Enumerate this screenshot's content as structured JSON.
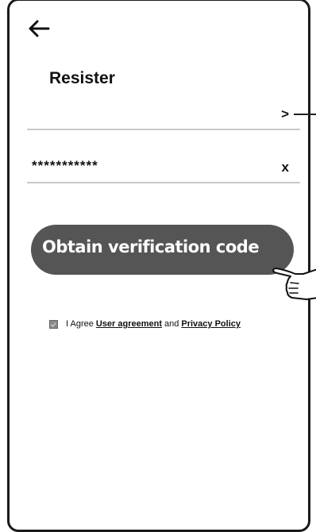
{
  "header": {
    "back_icon": "back-arrow-icon",
    "title": "Resister"
  },
  "form": {
    "account_field": {
      "value": "",
      "action": ">"
    },
    "password_field": {
      "value": "***********",
      "action": "x"
    },
    "obtain_button_label": "Obtain verification code"
  },
  "agreement": {
    "checked": true,
    "prefix": "I Agree",
    "user_agreement_link": "User agreement",
    "and_text": "and",
    "privacy_link": "Privacy Policy"
  },
  "annotation": {
    "pointer_icon": "pointing-hand-icon"
  },
  "colors": {
    "button_bg": "#555555",
    "button_text": "#ffffff",
    "divider": "#c8c8c8",
    "checkbox": "#8a8a8a"
  }
}
